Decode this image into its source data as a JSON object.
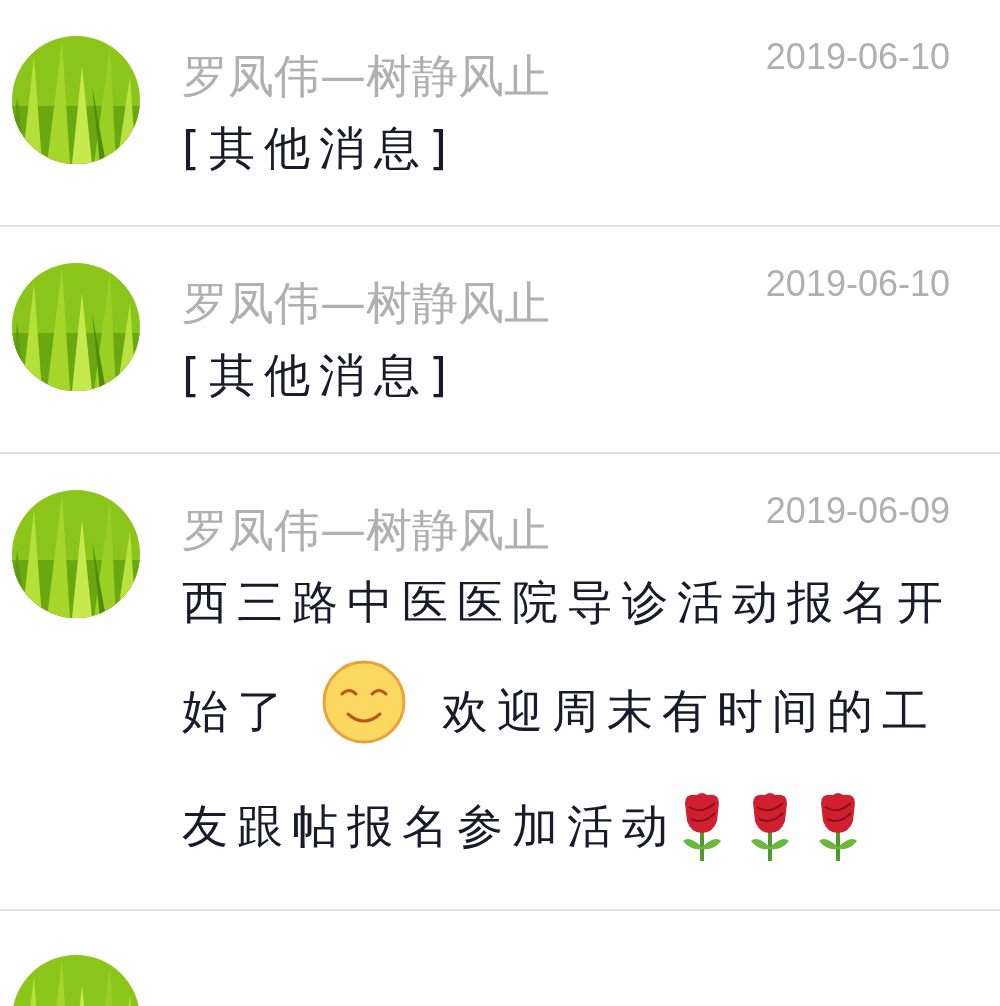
{
  "messages": [
    {
      "sender": "罗凤伟—树静风止",
      "date": "2019-06-10",
      "avatar": {
        "kind": "picture"
      },
      "body": [
        [
          {
            "kind": "text",
            "text": "[其他消息]"
          }
        ]
      ]
    },
    {
      "sender": "罗凤伟—树静风止",
      "date": "2019-06-10",
      "avatar": {
        "kind": "picture"
      },
      "body": [
        [
          {
            "kind": "text",
            "text": "[其他消息]"
          }
        ]
      ]
    },
    {
      "sender": "罗凤伟—树静风止",
      "date": "2019-06-09",
      "avatar": {
        "kind": "picture"
      },
      "body": [
        [
          {
            "kind": "text",
            "text": "西三路中医医院导诊活动报名开"
          }
        ],
        [
          {
            "kind": "text",
            "text": "始了"
          },
          {
            "kind": "smiley"
          },
          {
            "kind": "text",
            "text": "欢迎周末有时间的工"
          }
        ],
        [
          {
            "kind": "text",
            "text": "友跟帖报名参加活动"
          },
          {
            "kind": "rose"
          },
          {
            "kind": "rose"
          },
          {
            "kind": "rose"
          }
        ]
      ]
    }
  ],
  "next_item": {
    "avatar": {
      "kind": "picture"
    }
  }
}
